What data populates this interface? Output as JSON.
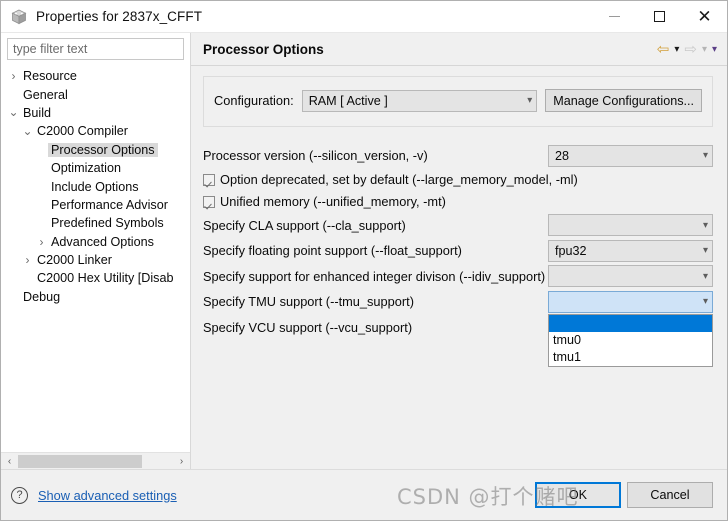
{
  "window": {
    "title": "Properties for 2837x_CFFT",
    "icon": "project-cube-icon",
    "minimize": "—",
    "maximize": "□",
    "close": "✕"
  },
  "sidebar": {
    "filter": {
      "placeholder": "type filter text",
      "value": ""
    },
    "items": [
      {
        "label": "Resource",
        "indent": 1,
        "twisty": "collapsed",
        "selected": false
      },
      {
        "label": "General",
        "indent": 1,
        "twisty": "none",
        "selected": false
      },
      {
        "label": "Build",
        "indent": 1,
        "twisty": "expanded",
        "selected": false
      },
      {
        "label": "C2000 Compiler",
        "indent": 2,
        "twisty": "expanded",
        "selected": false
      },
      {
        "label": "Processor Options",
        "indent": 3,
        "twisty": "none",
        "selected": true
      },
      {
        "label": "Optimization",
        "indent": 3,
        "twisty": "none",
        "selected": false
      },
      {
        "label": "Include Options",
        "indent": 3,
        "twisty": "none",
        "selected": false
      },
      {
        "label": "Performance Advisor",
        "indent": 3,
        "twisty": "none",
        "selected": false
      },
      {
        "label": "Predefined Symbols",
        "indent": 3,
        "twisty": "none",
        "selected": false
      },
      {
        "label": "Advanced Options",
        "indent": 3,
        "twisty": "collapsed",
        "selected": false
      },
      {
        "label": "C2000 Linker",
        "indent": 2,
        "twisty": "collapsed",
        "selected": false
      },
      {
        "label": "C2000 Hex Utility  [Disab",
        "indent": 2,
        "twisty": "none",
        "selected": false
      },
      {
        "label": "Debug",
        "indent": 1,
        "twisty": "none",
        "selected": false
      }
    ],
    "scroll": {
      "left_arrow": "‹",
      "right_arrow": "›"
    }
  },
  "panel": {
    "title": "Processor Options",
    "toolbar": [
      {
        "name": "back-arrow-icon",
        "glyph": "⇦",
        "color": "#d2a03c",
        "enabled": true
      },
      {
        "name": "back-menu-caret",
        "glyph": "▾",
        "color": "#1a1a1a",
        "enabled": true
      },
      {
        "name": "forward-arrow-icon",
        "glyph": "⇨",
        "color": "#c9c9c9",
        "enabled": false
      },
      {
        "name": "forward-menu-caret",
        "glyph": "▾",
        "color": "#b5b5b5",
        "enabled": false
      },
      {
        "name": "view-menu-caret",
        "glyph": "▾",
        "color": "#5b3f87",
        "enabled": true
      }
    ],
    "configuration": {
      "label": "Configuration:",
      "value": "RAM  [ Active ]",
      "manage_button": "Manage Configurations..."
    },
    "options": [
      {
        "type": "combo",
        "label": "Processor version (--silicon_version, -v)",
        "value": "28",
        "state": "normal"
      },
      {
        "type": "checkbox",
        "label": "Option deprecated, set by default (--large_memory_model, -ml)",
        "checked": true
      },
      {
        "type": "checkbox",
        "label": "Unified memory (--unified_memory, -mt)",
        "checked": true
      },
      {
        "type": "combo",
        "label": "Specify CLA support (--cla_support)",
        "value": "",
        "state": "normal"
      },
      {
        "type": "combo",
        "label": "Specify floating point support (--float_support)",
        "value": "fpu32",
        "state": "normal"
      },
      {
        "type": "combo",
        "label": "Specify support for enhanced integer divison (--idiv_support)",
        "value": "",
        "state": "normal"
      },
      {
        "type": "combo",
        "label": "Specify TMU support (--tmu_support)",
        "value": "",
        "state": "open"
      },
      {
        "type": "label",
        "label": "Specify VCU support (--vcu_support)"
      }
    ],
    "dropdown": {
      "open": true,
      "items": [
        {
          "label": "",
          "selected": true
        },
        {
          "label": "tmu0",
          "selected": false
        },
        {
          "label": "tmu1",
          "selected": false
        }
      ]
    }
  },
  "footer": {
    "help_icon": "?",
    "advanced_link": "Show advanced settings",
    "ok_button": "OK",
    "cancel_button": "Cancel"
  },
  "watermark": "CSDN @打个赌吧",
  "colors": {
    "accent": "#0078d7",
    "combo_active": "#cfe3f7",
    "link": "#1a5fb4",
    "selection_grey": "#d9d9d9"
  }
}
